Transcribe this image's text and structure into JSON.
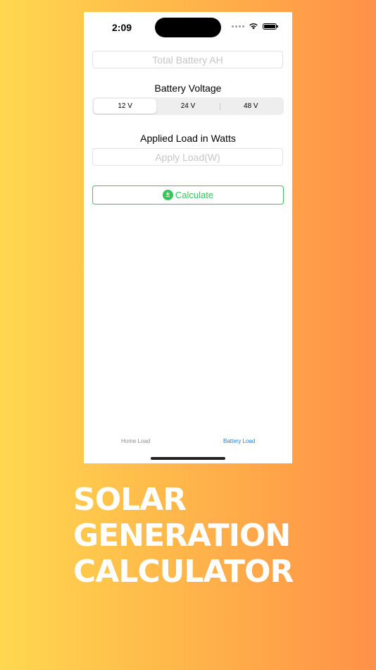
{
  "status_bar": {
    "time": "2:09"
  },
  "form": {
    "battery_ah": {
      "value": "",
      "placeholder": "Total Battery AH"
    },
    "voltage_label": "Battery Voltage",
    "voltage_options": [
      "12 V",
      "24 V",
      "48 V"
    ],
    "voltage_selected": "12 V",
    "load_label": "Applied Load in Watts",
    "load": {
      "value": "",
      "placeholder": "Apply Load(W)"
    },
    "calculate_label": "Calculate",
    "calculate_icon_glyph": "±"
  },
  "tab_bar": {
    "items": [
      {
        "label": "Home Load",
        "selected": false
      },
      {
        "label": "Battery Load",
        "selected": true
      }
    ]
  },
  "colors": {
    "accent_green": "#34c759",
    "tab_selected": "#1a7ee6",
    "tab_unselected": "#8e8e93"
  },
  "headline": {
    "lines": [
      "SOLAR",
      "GENERATION",
      "CALCULATOR"
    ]
  }
}
